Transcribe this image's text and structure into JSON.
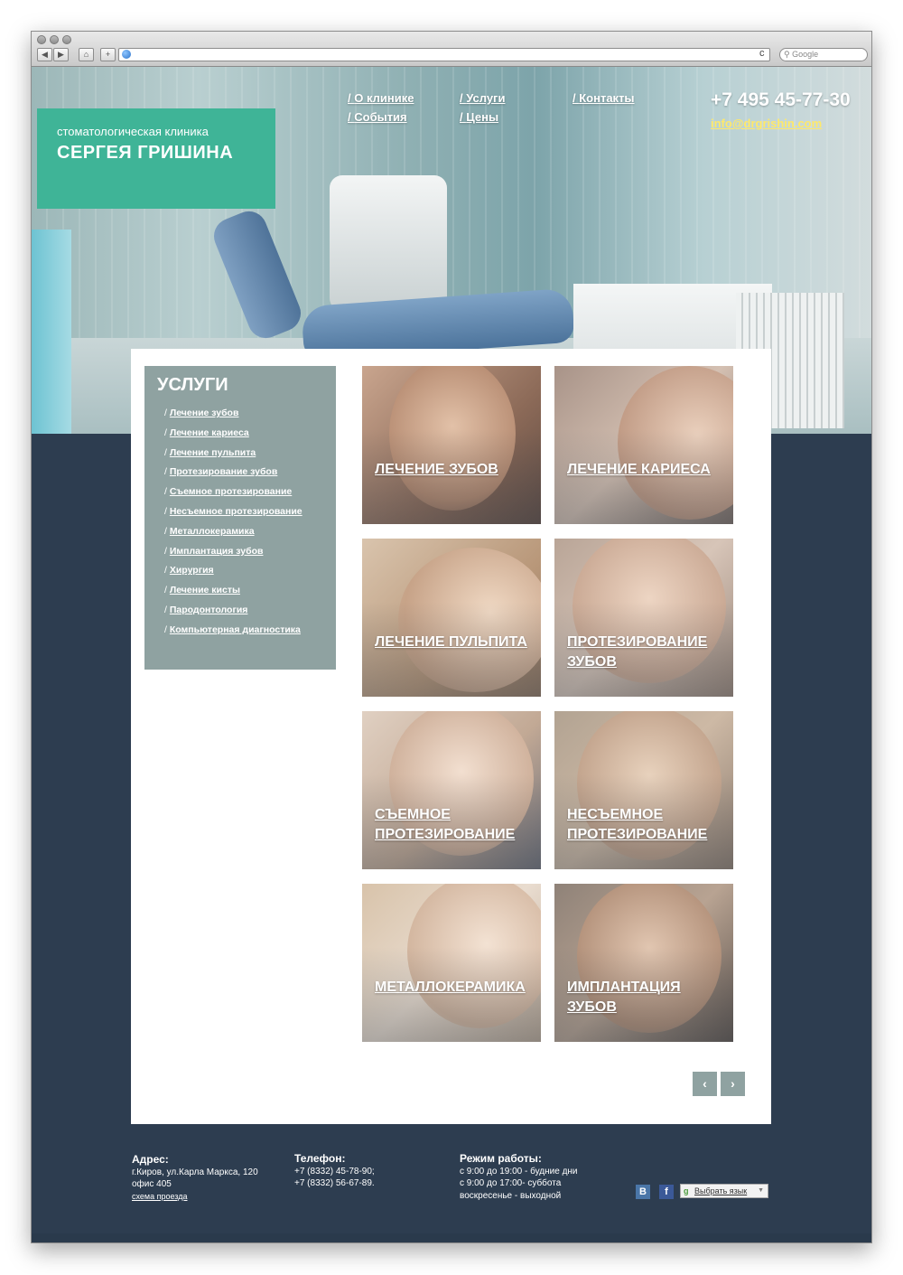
{
  "browser": {
    "search_placeholder": "Google",
    "buttons": {
      "back": "◀",
      "forward": "▶",
      "home": "⌂",
      "add": "+",
      "reload": "c"
    }
  },
  "header": {
    "logo_sub": "стоматологическая клиника",
    "logo_main": "СЕРГЕЯ ГРИШИНА",
    "nav": [
      {
        "label": "О клинике"
      },
      {
        "label": "События"
      },
      {
        "label": "Услуги"
      },
      {
        "label": "Цены"
      },
      {
        "label": "Контакты"
      }
    ],
    "phone": "+7 495 45-77-30",
    "email": "info@drgrishin.com"
  },
  "sidebar": {
    "title": "УСЛУГИ",
    "items": [
      {
        "label": "Лечение зубов"
      },
      {
        "label": "Лечение кариеса"
      },
      {
        "label": "Лечение пульпита"
      },
      {
        "label": "Протезирование зубов"
      },
      {
        "label": "Съемное протезирование"
      },
      {
        "label": "Несъемное протезирование"
      },
      {
        "label": "Металлокерамика"
      },
      {
        "label": "Имплантация зубов"
      },
      {
        "label": "Хирургия"
      },
      {
        "label": "Лечение кисты"
      },
      {
        "label": "Пародонтология"
      },
      {
        "label": "Компьютерная диагностика"
      }
    ]
  },
  "tiles": [
    {
      "line1": "ЛЕЧЕНИЕ ЗУБОВ",
      "line2": ""
    },
    {
      "line1": "ЛЕЧЕНИЕ КАРИЕСА",
      "line2": ""
    },
    {
      "line1": "ЛЕЧЕНИЕ ПУЛЬПИТА",
      "line2": ""
    },
    {
      "line1": "ПРОТЕЗИРОВАНИЕ",
      "line2": "ЗУБОВ"
    },
    {
      "line1": "СЪЕМНОЕ",
      "line2": "ПРОТЕЗИРОВАНИЕ"
    },
    {
      "line1": "НЕСЪЕМНОЕ",
      "line2": "ПРОТЕЗИРОВАНИЕ"
    },
    {
      "line1": "МЕТАЛЛОКЕРАМИКА",
      "line2": ""
    },
    {
      "line1": "ИМПЛАНТАЦИЯ",
      "line2": "ЗУБОВ"
    }
  ],
  "pager": {
    "prev": "‹",
    "next": "›"
  },
  "footer": {
    "address_title": "Адрес:",
    "address_line1": "г.Киров, ул.Карла Маркса, 120",
    "address_line2": "офис 405",
    "map_link": "схема проезда",
    "phone_title": "Телефон:",
    "phone_line1": "+7 (8332) 45-78-90;",
    "phone_line2": "+7 (8332) 56-67-89.",
    "hours_title": "Режим работы:",
    "hours_line1": "с 9:00 до 19:00 - будние дни",
    "hours_line2": "с 9:00 до 17:00- суббота",
    "hours_line3": "воскресенье - выходной",
    "social": {
      "vk": "В",
      "fb": "f"
    },
    "lang_label": "Выбрать язык",
    "lang_arrow": "▼"
  },
  "colors": {
    "accent": "#3fb497",
    "sidebar": "#8fa2a1",
    "dark_bg": "#2d3d50",
    "email": "#ffe96a",
    "vk": "#4a76a8",
    "fb": "#3b5998"
  }
}
